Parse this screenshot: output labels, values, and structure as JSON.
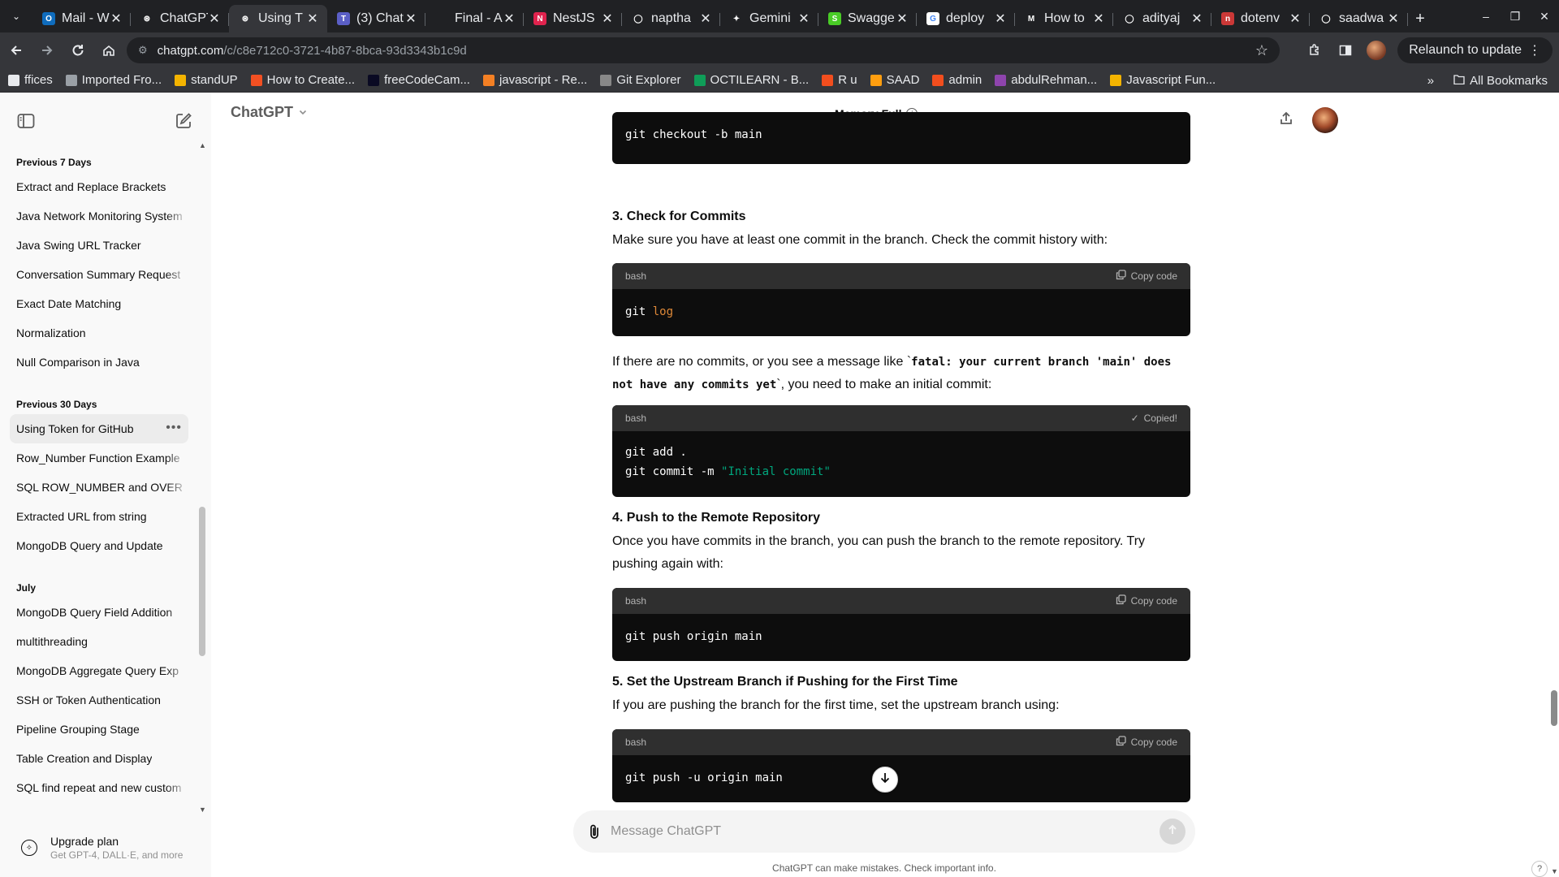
{
  "browser": {
    "tabs": [
      {
        "title": "Mail - W",
        "favicon_color": "#0f6cbd",
        "favicon_glyph": "O",
        "active": false
      },
      {
        "title": "ChatGPT",
        "favicon_color": "#202124",
        "favicon_glyph": "⊛",
        "active": false
      },
      {
        "title": "Using T",
        "favicon_color": "#35363a",
        "favicon_glyph": "⊛",
        "active": true
      },
      {
        "title": "(3) Chat",
        "favicon_color": "#5b5fc7",
        "favicon_glyph": "T",
        "active": false
      },
      {
        "title": "Final - A",
        "favicon_color": "#202124",
        "favicon_glyph": "",
        "active": false
      },
      {
        "title": "NestJS",
        "favicon_color": "#e0234e",
        "favicon_glyph": "N",
        "active": false
      },
      {
        "title": "naptha",
        "favicon_color": "#202124",
        "favicon_glyph": "◯",
        "active": false
      },
      {
        "title": "Gemini",
        "favicon_color": "#202124",
        "favicon_glyph": "✦",
        "active": false
      },
      {
        "title": "Swagger",
        "favicon_color": "#49cc26",
        "favicon_glyph": "S",
        "active": false
      },
      {
        "title": "deploy",
        "favicon_color": "#ffffff",
        "favicon_glyph": "G",
        "active": false
      },
      {
        "title": "How to",
        "favicon_color": "#202124",
        "favicon_glyph": "M",
        "active": false
      },
      {
        "title": "adityaj",
        "favicon_color": "#202124",
        "favicon_glyph": "◯",
        "active": false
      },
      {
        "title": "dotenv",
        "favicon_color": "#cb3837",
        "favicon_glyph": "n",
        "active": false
      },
      {
        "title": "saadwa",
        "favicon_color": "#202124",
        "favicon_glyph": "◯",
        "active": false
      }
    ],
    "url_host": "chatgpt.com",
    "url_path": "/c/c8e712c0-3721-4b87-8bca-93d3343b1c9d",
    "relaunch_label": "Relaunch to update",
    "bookmarks": [
      {
        "label": "ffices",
        "color": "#e8eaed"
      },
      {
        "label": "Imported Fro...",
        "color": "#9aa0a6"
      },
      {
        "label": "standUP",
        "color": "#f4b400"
      },
      {
        "label": "How to Create...",
        "color": "#f25022"
      },
      {
        "label": "freeCodeCam...",
        "color": "#0a0a23"
      },
      {
        "label": "javascript - Re...",
        "color": "#f48024"
      },
      {
        "label": "Git Explorer",
        "color": "#888888"
      },
      {
        "label": "OCTILEARN - B...",
        "color": "#0f9d58"
      },
      {
        "label": "R u",
        "color": "#f24e1e"
      },
      {
        "label": "SAAD",
        "color": "#ff9e0f"
      },
      {
        "label": "admin",
        "color": "#f24e1e"
      },
      {
        "label": "abdulRehman...",
        "color": "#8e44ad"
      },
      {
        "label": "Javascript Fun...",
        "color": "#f4b400"
      }
    ],
    "all_bookmarks_label": "All Bookmarks"
  },
  "sidebar": {
    "groups": [
      {
        "title": "Previous 7 Days",
        "items": [
          {
            "label": "Extract and Replace Brackets"
          },
          {
            "label": "Java Network Monitoring System"
          },
          {
            "label": "Java Swing URL Tracker"
          },
          {
            "label": "Conversation Summary Request"
          },
          {
            "label": "Exact Date Matching"
          },
          {
            "label": "Normalization"
          },
          {
            "label": "Null Comparison in Java"
          }
        ]
      },
      {
        "title": "Previous 30 Days",
        "items": [
          {
            "label": "Using Token for GitHub"
          },
          {
            "label": "Row_Number Function Example"
          },
          {
            "label": "SQL ROW_NUMBER and OVER clause"
          },
          {
            "label": "Extracted URL from string"
          },
          {
            "label": "MongoDB Query and Update"
          }
        ]
      },
      {
        "title": "July",
        "items": [
          {
            "label": "MongoDB Query Field Addition"
          },
          {
            "label": "multithreading"
          },
          {
            "label": "MongoDB Aggregate Query Exp"
          },
          {
            "label": "SSH or Token Authentication"
          },
          {
            "label": "Pipeline Grouping Stage"
          },
          {
            "label": "Table Creation and Display"
          },
          {
            "label": "SQL find repeat and new custom"
          }
        ]
      }
    ],
    "upgrade": {
      "title": "Upgrade plan",
      "subtitle": "Get GPT-4, DALL·E, and more"
    }
  },
  "header": {
    "model_label": "ChatGPT",
    "memory_label": "Memory Full"
  },
  "conversation": {
    "code1": {
      "line": "git checkout -b main"
    },
    "step3_heading": "3. Check for Commits",
    "step3_text": "Make sure you have at least one commit in the branch. Check the commit history with:",
    "code2": {
      "lang": "bash",
      "copy": "Copy code",
      "cmd": "git",
      "arg": "log"
    },
    "para_before": "If there are no commits, or you see a message like `",
    "para_code": "fatal: your current branch 'main' does not have any commits yet",
    "para_after": "`, you need to make an initial commit:",
    "code3": {
      "lang": "bash",
      "copy": "Copied!",
      "line1": "git add .",
      "line2_cmd": "git commit -m ",
      "line2_str": "\"Initial commit\""
    },
    "step4_heading": "4. Push to the Remote Repository",
    "step4_text": "Once you have commits in the branch, you can push the branch to the remote repository. Try pushing again with:",
    "code4": {
      "lang": "bash",
      "copy": "Copy code",
      "line": "git push origin main"
    },
    "step5_heading": "5. Set the Upstream Branch if Pushing for the First Time",
    "step5_text": "If you are pushing the branch for the first time, set the upstream branch using:",
    "code5": {
      "lang": "bash",
      "copy": "Copy code",
      "line": "git push -u origin main"
    }
  },
  "composer": {
    "placeholder": "Message ChatGPT",
    "disclaimer": "ChatGPT can make mistakes. Check important info.",
    "help": "?"
  },
  "icons": [
    "chevron-down-icon",
    "back-icon",
    "forward-icon",
    "reload-icon",
    "home-icon",
    "star-icon",
    "extensions-icon",
    "sidepanel-icon",
    "sidebar-toggle-icon",
    "new-chat-icon",
    "info-icon",
    "share-icon",
    "paperclip-icon",
    "send-arrow-icon",
    "arrow-down-icon",
    "copy-icon",
    "check-icon",
    "folder-icon"
  ]
}
